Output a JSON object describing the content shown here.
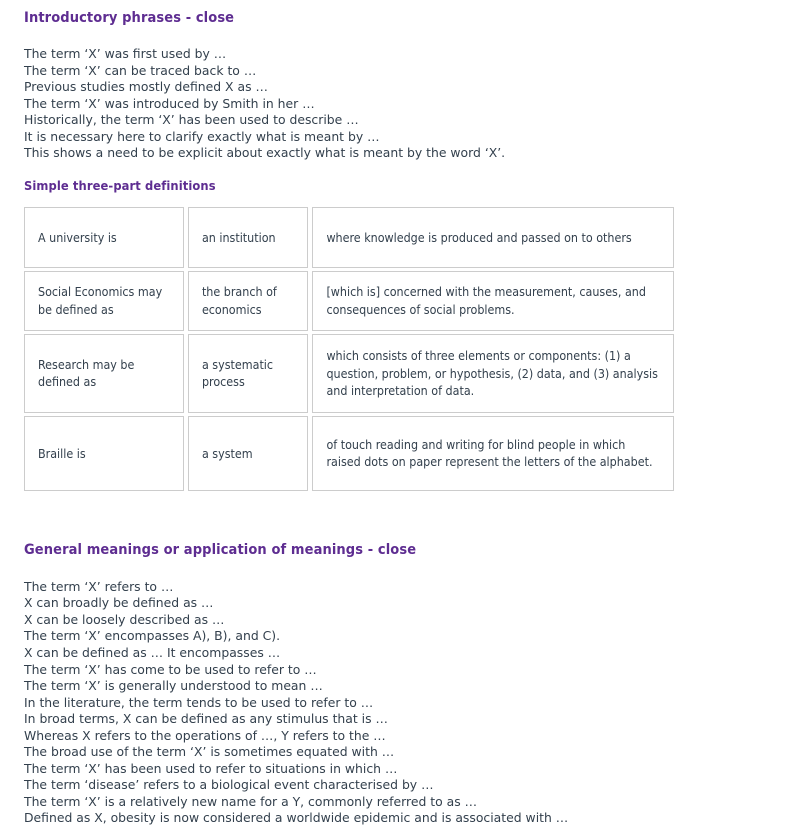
{
  "colors": {
    "heading": "#5e2d91",
    "body_text": "#33404d",
    "table_border": "#cccccc",
    "page_background": "#ffffff"
  },
  "sections": {
    "intro": {
      "heading": "Introductory phrases - close",
      "lines": [
        "The term ‘X’ was first used by …",
        "The term ‘X’ can be traced back to …",
        "Previous studies mostly defined X as …",
        "The term ‘X’ was introduced by Smith in her …",
        "Historically, the term ‘X’ has been used to describe …",
        "It is necessary here to clarify exactly what is meant by …",
        "This shows a need to be explicit about exactly what is meant by the word ‘X’."
      ]
    },
    "three_part": {
      "heading": "Simple three-part definitions",
      "rows": [
        {
          "subject": "A university is",
          "verb": "an institution",
          "detail": "where knowledge is produced and passed on to others"
        },
        {
          "subject": "Social Economics may be defined as",
          "verb": "the branch of economics",
          "detail": "[which is] concerned with the measurement, causes, and consequences of social problems."
        },
        {
          "subject": "Research may be defined as",
          "verb": "a systematic process",
          "detail": "which consists of three elements or components: (1) a question, problem, or hypothesis, (2) data, and (3) analysis and interpretation of data."
        },
        {
          "subject": "Braille is",
          "verb": "a system",
          "detail": "of touch reading and writing for blind people in which raised dots on paper represent the letters of the alphabet."
        }
      ]
    },
    "general_meanings": {
      "heading": "General meanings or application of meanings - close",
      "lines": [
        "The term ‘X’ refers to …",
        "X can broadly be defined as …",
        "X can be loosely described as …",
        "The term ‘X’ encompasses A), B), and C).",
        "X can be defined as … It encompasses …",
        "The term ‘X’ has come to be used to refer to …",
        "The term ‘X’ is generally understood to mean …",
        "In the literature, the term tends to be used to refer to …",
        "In broad terms, X can be defined as any stimulus that is …",
        "Whereas X refers to the operations of …, Y refers to the …",
        "The broad use of the term ‘X’ is sometimes equated with …",
        "The term ‘X’ has been used to refer to situations in which …",
        "The term ‘disease’ refers to a biological event characterised by …",
        "The term ‘X’ is a relatively new name for a Y, commonly referred to as …",
        "Defined as X, obesity is now considered a worldwide epidemic and is associated with …"
      ]
    }
  }
}
